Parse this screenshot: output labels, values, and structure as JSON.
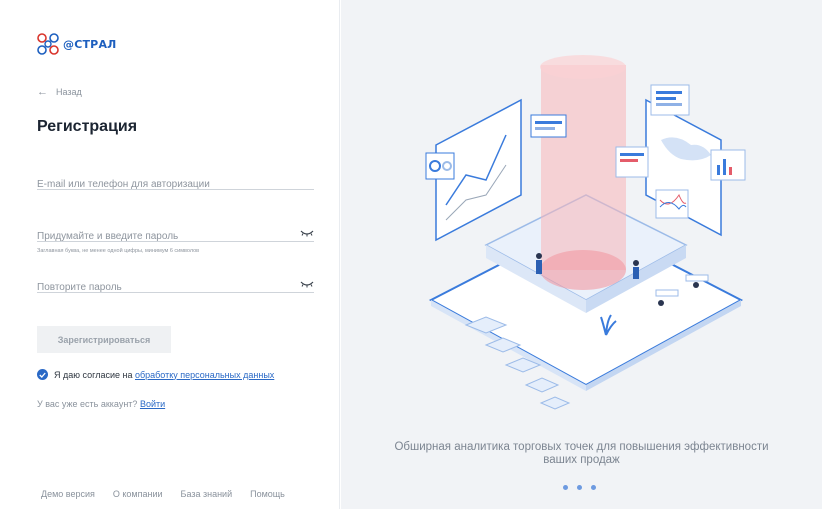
{
  "logo": {
    "text": "@СТРАЛ"
  },
  "nav": {
    "back_label": "Назад"
  },
  "form": {
    "title": "Регистрация",
    "login_placeholder": "E-mail или телефон для авторизации",
    "password_placeholder": "Придумайте и введите пароль",
    "password_hint": "Заглавная буква, не менее одной цифры, минимум 6 символов",
    "repeat_placeholder": "Повторите пароль",
    "submit_label": "Зарегистрироваться",
    "consent_text": "Я даю согласие на",
    "consent_link": "обработку персональных данных",
    "account_text": "У вас уже есть аккаунт?",
    "login_link": "Войти"
  },
  "footer": {
    "items": [
      "Демо версия",
      "О компании",
      "База знаний",
      "Помощь"
    ]
  },
  "promo": {
    "caption_line1": "Обширная аналитика торговых точек для повышения эффективности",
    "caption_line2": "ваших продаж",
    "slides": 3
  },
  "colors": {
    "accent": "#2a69c6",
    "brand": "#1d5fbf",
    "panel_bg": "#f1f3f6"
  }
}
